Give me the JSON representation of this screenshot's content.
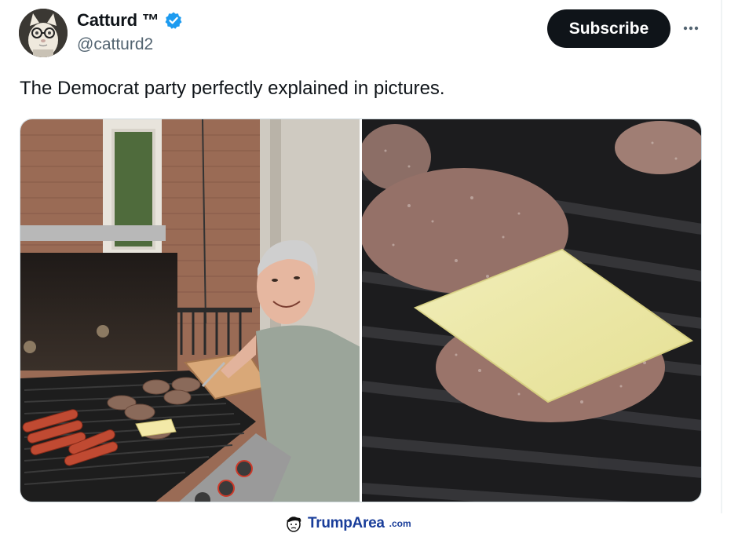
{
  "author": {
    "display_name": "Catturd ™",
    "handle": "@catturd2",
    "avatar_icon": "cat-with-glasses-avatar",
    "verified_icon": "verified-badge-icon",
    "verified_color": "#1d9bf0"
  },
  "header": {
    "subscribe_label": "Subscribe",
    "more_icon": "more-dots-icon"
  },
  "tweet": {
    "text": "The Democrat party perfectly explained in pictures."
  },
  "media": [
    {
      "name": "grill-photo"
    },
    {
      "name": "burger-closeup-photo"
    }
  ],
  "watermark": {
    "text": "TrumpArea",
    "suffix": ".com",
    "icon": "trump-face-icon",
    "color": "#1a3e9a"
  }
}
